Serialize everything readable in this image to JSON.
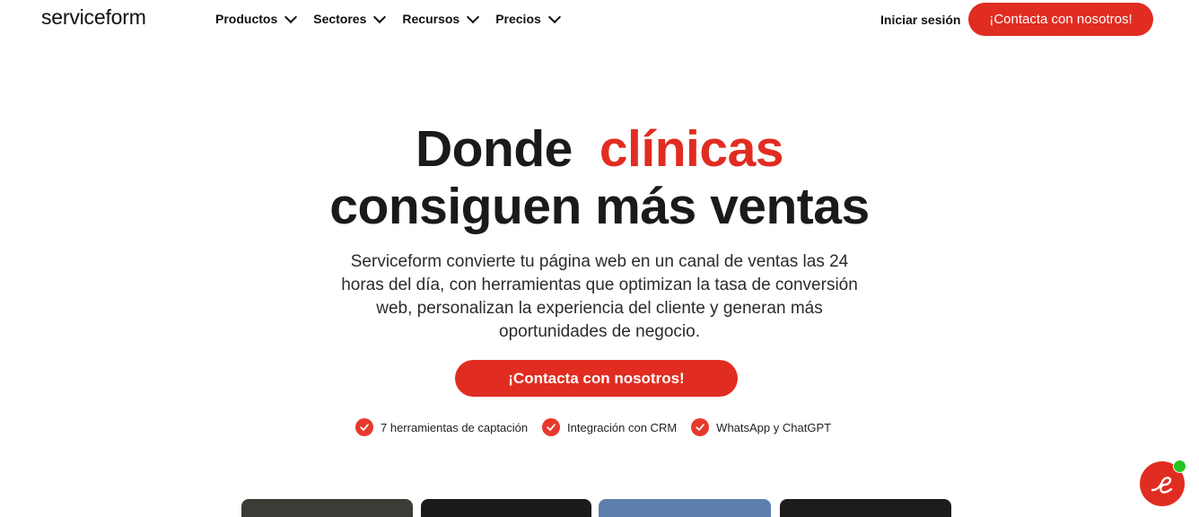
{
  "header": {
    "logo": "serviceform",
    "nav": [
      {
        "label": "Productos"
      },
      {
        "label": "Sectores"
      },
      {
        "label": "Recursos"
      },
      {
        "label": "Precios"
      }
    ],
    "login_label": "Iniciar sesión",
    "cta_label": "¡Contacta con nosotros!"
  },
  "hero": {
    "title_part1": "Donde",
    "title_accent": "clínicas",
    "title_line2": "consiguen más ventas",
    "description": "Serviceform convierte tu página web en un canal de ventas las 24 horas del día, con herramientas que optimizan la tasa de conversión web, personalizan la experiencia del cliente y generan más oportunidades de negocio.",
    "cta_label": "¡Contacta con nosotros!",
    "features": [
      {
        "label": "7 herramientas de captación"
      },
      {
        "label": "Integración con CRM"
      },
      {
        "label": "WhatsApp y ChatGPT"
      }
    ]
  },
  "colors": {
    "brand_red": "#e12c21",
    "online_green": "#22c51d"
  },
  "icons": {
    "nav_dropdown": "chevron-down-icon",
    "feature_check": "check-circle-icon",
    "chat_widget": "chat-widget-icon"
  }
}
